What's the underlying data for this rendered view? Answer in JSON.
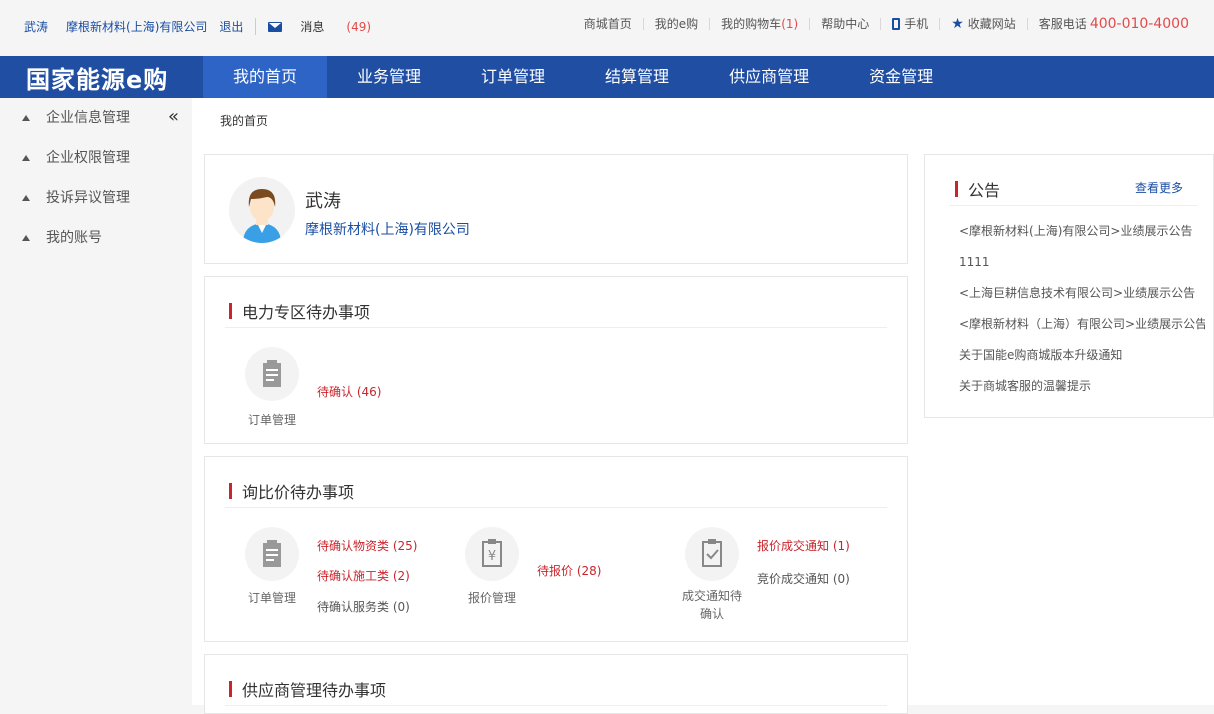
{
  "topbar": {
    "user": "武涛",
    "company": "摩根新材料(上海)有限公司",
    "logout": "退出",
    "message_label": "消息",
    "message_count": "(49)",
    "links": [
      "商城首页",
      "我的e购"
    ],
    "cart_label": "我的购物车",
    "cart_count": "(1)",
    "help": "帮助中心",
    "phone": "手机",
    "favorite": "收藏网站",
    "hotline_label": "客服电话",
    "hotline_number": "400-010-4000"
  },
  "nav": {
    "logo": "国家能源e购",
    "items": [
      "我的首页",
      "业务管理",
      "订单管理",
      "结算管理",
      "供应商管理",
      "资金管理"
    ],
    "active": "我的首页"
  },
  "sidebar": {
    "collapse_icon": "«",
    "items": [
      "企业信息管理",
      "企业权限管理",
      "投诉异议管理",
      "我的账号"
    ]
  },
  "breadcrumb": "我的首页",
  "profile": {
    "name": "武涛",
    "company": "摩根新材料(上海)有限公司"
  },
  "sections": {
    "power": {
      "title": "电力专区待办事项",
      "icon_label": "订单管理",
      "items": [
        {
          "text": "待确认 (46)",
          "style": "red"
        }
      ]
    },
    "inquiry": {
      "title": "询比价待办事项",
      "order": {
        "label": "订单管理",
        "items": [
          "待确认物资类 (25)",
          "待确认施工类 (2)",
          "待确认服务类 (0)"
        ]
      },
      "quote": {
        "label": "报价管理",
        "items": [
          "待报价 (28)"
        ]
      },
      "deal": {
        "label_line1": "成交通知待",
        "label_line2": "确认",
        "items": [
          "报价成交通知 (1)",
          "竞价成交通知 (0)"
        ]
      }
    },
    "supplier": {
      "title": "供应商管理待办事项"
    }
  },
  "notice": {
    "title": "公告",
    "more": "查看更多",
    "items": [
      "<摩根新材料(上海)有限公司>业绩展示公告",
      "1111",
      "<上海巨耕信息技术有限公司>业绩展示公告",
      "<摩根新材料（上海）有限公司>业绩展示公告",
      "关于国能e购商城版本升级通知",
      "关于商城客服的温馨提示"
    ]
  },
  "colors": {
    "nav_bg": "#1f4ea3",
    "nav_active": "#2d64c6",
    "accent_red": "#c9252c",
    "link_blue": "#1a4ea3"
  }
}
